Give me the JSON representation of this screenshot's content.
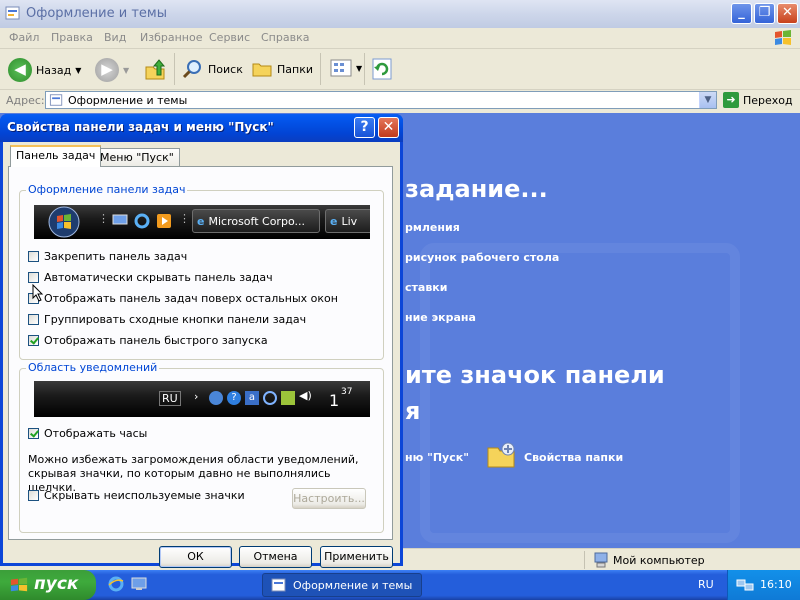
{
  "explorer": {
    "title": "Оформление и темы",
    "menu": [
      "Файл",
      "Правка",
      "Вид",
      "Избранное",
      "Сервис",
      "Справка"
    ],
    "toolbar": {
      "back_label": "Назад",
      "search_label": "Поиск",
      "folders_label": "Папки"
    },
    "address": {
      "label": "Адрес:",
      "value": "Оформление и темы",
      "go_label": "Переход"
    },
    "content": {
      "heading1": "задание...",
      "links": [
        "рмления",
        "рисунок рабочего стола",
        "ставки",
        "ние экрана"
      ],
      "heading2": "ите значок панели",
      "heading2_line2": "я",
      "start_menu_link": "ню \"Пуск\"",
      "folder_options_link": "Свойства папки"
    },
    "status": {
      "computer": "Мой компьютер"
    }
  },
  "dialog": {
    "title": "Свойства панели задач и меню \"Пуск\"",
    "tabs": [
      {
        "label": "Панель задач",
        "active": true
      },
      {
        "label": "Меню \"Пуск\"",
        "active": false
      }
    ],
    "taskbar_group": {
      "legend": "Оформление панели задач",
      "preview_items": [
        "Microsoft Corpo...",
        "Liv"
      ],
      "options": [
        {
          "label": "Закрепить панель задач",
          "checked": false
        },
        {
          "label": "Автоматически скрывать панель задач",
          "checked": false
        },
        {
          "label": "Отображать панель задач поверх остальных окон",
          "checked": false
        },
        {
          "label": "Группировать сходные кнопки панели задач",
          "checked": false
        },
        {
          "label": "Отображать панель быстрого запуска",
          "checked": true
        }
      ]
    },
    "notify_group": {
      "legend": "Область уведомлений",
      "preview_lang": "RU",
      "preview_clock": "1",
      "preview_clock_sup": "37",
      "show_clock": {
        "label": "Отображать часы",
        "checked": true
      },
      "description": "Можно избежать загромождения области уведомлений, скрывая значки, по которым давно не выполнялись щелчки.",
      "hide_icons": {
        "label": "Скрывать неиспользуемые значки",
        "checked": false
      },
      "customize_label": "Настроить..."
    },
    "buttons": {
      "ok": "ОК",
      "cancel": "Отмена",
      "apply": "Применить"
    }
  },
  "taskbar": {
    "start_label": "пуск",
    "task_label": "Оформление и темы",
    "lang": "RU",
    "clock": "16:10"
  }
}
